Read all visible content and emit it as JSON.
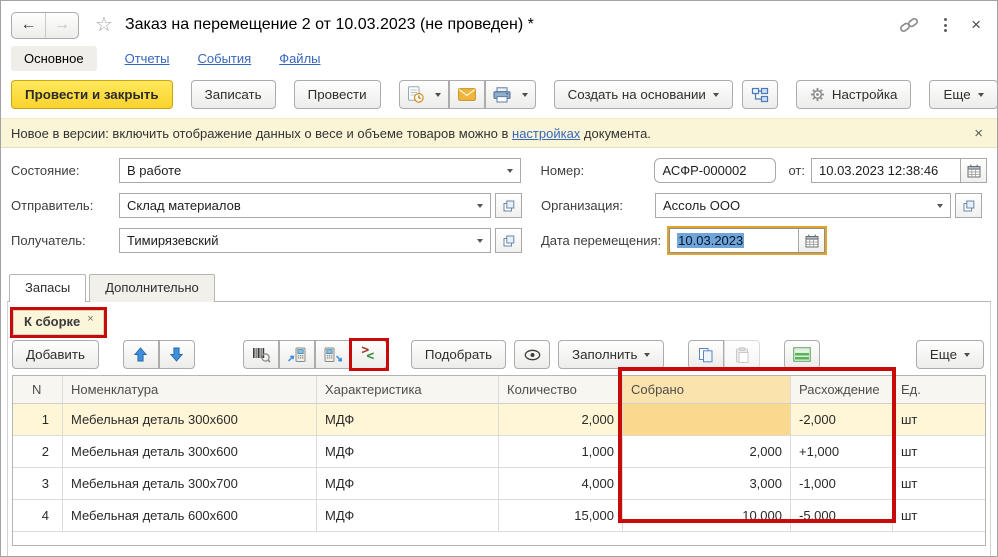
{
  "window": {
    "title": "Заказ на перемещение 2 от 10.03.2023 (не проведен) *"
  },
  "icons": {
    "back": "←",
    "forward": "→",
    "favorite": "☆",
    "menu": "⋮",
    "close": "×",
    "help": "?",
    "compare_gt": ">",
    "compare_lt": "<"
  },
  "nav_tabs": [
    {
      "label": "Основное",
      "active": true
    },
    {
      "label": "Отчеты",
      "active": false
    },
    {
      "label": "События",
      "active": false
    },
    {
      "label": "Файлы",
      "active": false
    }
  ],
  "toolbar": {
    "post_and_close": "Провести и закрыть",
    "save": "Записать",
    "post": "Провести",
    "create_based_on": "Создать на основании",
    "settings": "Настройка",
    "more": "Еще",
    "help": "?"
  },
  "banner": {
    "text_before": "Новое в версии: включить отображение данных о весе и объеме товаров можно в ",
    "link": "настройках",
    "text_after": " документа.",
    "close": "×"
  },
  "fields": {
    "state": {
      "label": "Состояние:",
      "value": "В работе"
    },
    "sender": {
      "label": "Отправитель:",
      "value": "Склад материалов"
    },
    "receiver": {
      "label": "Получатель:",
      "value": "Тимирязевский"
    },
    "number": {
      "label": "Номер:",
      "value": "АСФР-000002"
    },
    "date_from": {
      "label": "от:",
      "value": "10.03.2023 12:38:46"
    },
    "organization": {
      "label": "Организация:",
      "value": "Ассоль ООО"
    },
    "move_date": {
      "label": "Дата перемещения:",
      "value": "10.03.2023"
    }
  },
  "page_tabs": {
    "inventory": "Запасы",
    "additional": "Дополнительно"
  },
  "chip": {
    "label": "К сборке",
    "close": "×"
  },
  "table_toolbar": {
    "add": "Добавить",
    "pick": "Подобрать",
    "fill": "Заполнить",
    "more": "Еще"
  },
  "table": {
    "headers": [
      "N",
      "Номенклатура",
      "Характеристика",
      "Количество",
      "Собрано",
      "Расхождение",
      "Ед."
    ],
    "rows": [
      {
        "n": "1",
        "name": "Мебельная деталь 300х600",
        "char": "МДФ",
        "qty": "2,000",
        "collected": "",
        "diff": "-2,000",
        "unit": "шт"
      },
      {
        "n": "2",
        "name": "Мебельная деталь 300х600",
        "char": "МДФ",
        "qty": "1,000",
        "collected": "2,000",
        "diff": "+1,000",
        "unit": "шт"
      },
      {
        "n": "3",
        "name": "Мебельная деталь 300х700",
        "char": "МДФ",
        "qty": "4,000",
        "collected": "3,000",
        "diff": "-1,000",
        "unit": "шт"
      },
      {
        "n": "4",
        "name": "Мебельная деталь 600х600",
        "char": "МДФ",
        "qty": "15,000",
        "collected": "10,000",
        "diff": "-5,000",
        "unit": "шт"
      }
    ]
  },
  "colors": {
    "annotation_red": "#C80A0A",
    "primary_button_yellow": "#FAD22C",
    "banner_yellow": "#FBF5D8",
    "highlight_column_header": "#FBE3AE",
    "current_row": "#FFF6D8",
    "current_cell_highlight": "#FAD98F",
    "link_blue": "#3566BE",
    "selection_blue": "#6FA5D8",
    "focus_ring_orange": "#DFA528"
  }
}
